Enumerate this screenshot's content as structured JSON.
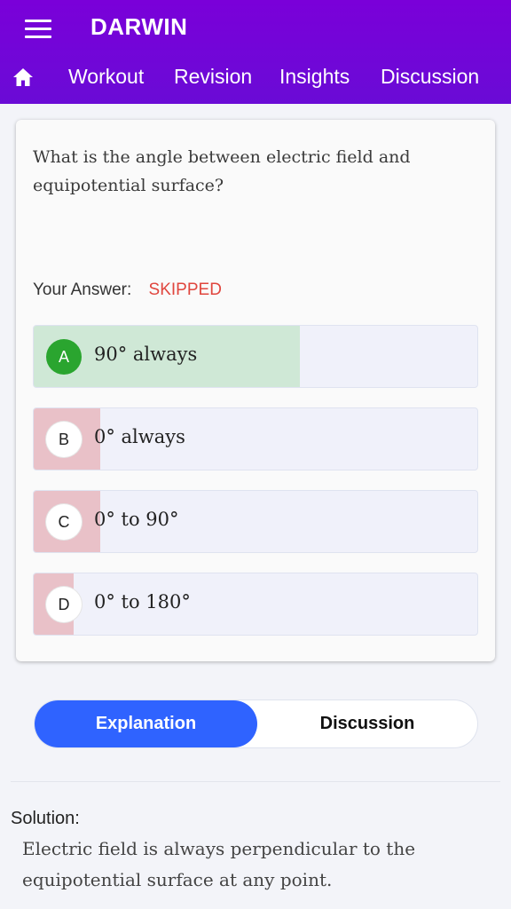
{
  "app": {
    "title": "DARWIN",
    "brand_color": "#7a00d9"
  },
  "nav": {
    "tabs": [
      {
        "label": "Workout"
      },
      {
        "label": "Revision"
      },
      {
        "label": "Insights"
      },
      {
        "label": "Discussion"
      }
    ],
    "icons": [
      "menu-icon",
      "home-icon"
    ]
  },
  "question": {
    "text": "What is the angle between electric field and equipotential surface?",
    "your_answer_label": "Your Answer:",
    "your_answer_value": "SKIPPED",
    "options": [
      {
        "letter": "A",
        "text": "90° always",
        "status": "correct",
        "percent": 60
      },
      {
        "letter": "B",
        "text": "0° always",
        "status": "wrong",
        "percent": 15
      },
      {
        "letter": "C",
        "text": "0° to 90°",
        "status": "wrong",
        "percent": 15
      },
      {
        "letter": "D",
        "text": "0° to 180°",
        "status": "wrong",
        "percent": 9
      }
    ]
  },
  "segment": {
    "explanation_label": "Explanation",
    "discussion_label": "Discussion",
    "active": "Explanation"
  },
  "solution": {
    "title": "Solution:",
    "text": "Electric field is always perpendicular to the equipotential surface at any point."
  },
  "colors": {
    "correct": "#2aa52f",
    "skipped": "#e0463e",
    "toggle_active": "#2f63ff"
  }
}
